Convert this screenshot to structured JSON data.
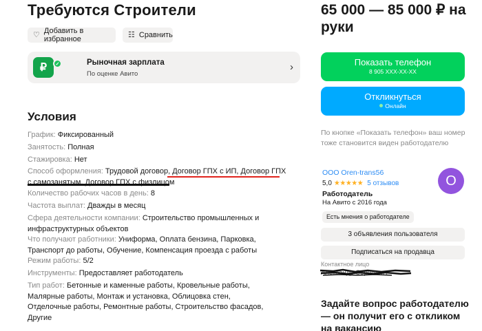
{
  "title": "Требуются Строители",
  "actions": {
    "favorite_label": "Добавить в избранное",
    "compare_label": "Сравнить"
  },
  "market": {
    "title": "Рыночная зарплата",
    "subtitle": "По оценке Авито",
    "icon_symbol": "₽"
  },
  "conditions": {
    "heading": "Условия",
    "items": [
      {
        "key": "График:",
        "value": "Фиксированный"
      },
      {
        "key": "Занятость:",
        "value": "Полная"
      },
      {
        "key": "Стажировка:",
        "value": "Нет"
      },
      {
        "key": "Способ оформления:",
        "value": "Трудовой договор, Договор ГПХ с ИП, Договор ГПХ с самозанятым, Договор ГПХ с физлицом"
      },
      {
        "key": "Количество рабочих часов в день:",
        "value": "8"
      },
      {
        "key": "Частота выплат:",
        "value": "Дважды в месяц"
      },
      {
        "key": "Сфера деятельности компании:",
        "value": "Строительство промышленных и инфраструктурных объектов"
      },
      {
        "key": "Что получают работники:",
        "value": "Униформа, Оплата бензина, Парковка, Транспорт до работы, Обучение, Компенсация проезда с работы"
      },
      {
        "key": "Режим работы:",
        "value": "5/2"
      },
      {
        "key": "Инструменты:",
        "value": "Предоставляет работодатель"
      },
      {
        "key": "Тип работ:",
        "value": "Бетонные и каменные работы, Кровельные работы, Малярные работы, Монтаж и установка, Облицовка стен, Отделочные работы, Ремонтные работы, Строительство фасадов, Другие"
      }
    ]
  },
  "price": "65 000 — 85 000 ₽ на руки",
  "phone_button": {
    "label": "Показать телефон",
    "sub": "8 905 XXX-XX-XX"
  },
  "respond_button": {
    "label": "Откликнуться",
    "sub": "Онлайн"
  },
  "notice": "По кнопке «Показать телефон» ваш номер тоже становится виден работодателю",
  "seller": {
    "company": "ООО Oren-trans56",
    "rating": "5,0",
    "stars": "★★★★★",
    "reviews": "5 отзывов",
    "avatar_letter": "O",
    "type": "Работодатель",
    "since": "На Авито с 2016 года",
    "opinion_chip": "Есть мнения о работодателе",
    "ads_button": "3 объявления пользователя",
    "subscribe_button": "Подписаться на продавца",
    "contact_label": "Контактное лицо",
    "contact_name": "Александр Сергеевич"
  },
  "ask": "Задайте вопрос работодателю — он получит его с откликом на вакансию",
  "colors": {
    "green": "#02d15c",
    "blue": "#00aaff",
    "link": "#2c8cf4",
    "avatar": "#9254de",
    "underline_red": "#e0221c"
  }
}
